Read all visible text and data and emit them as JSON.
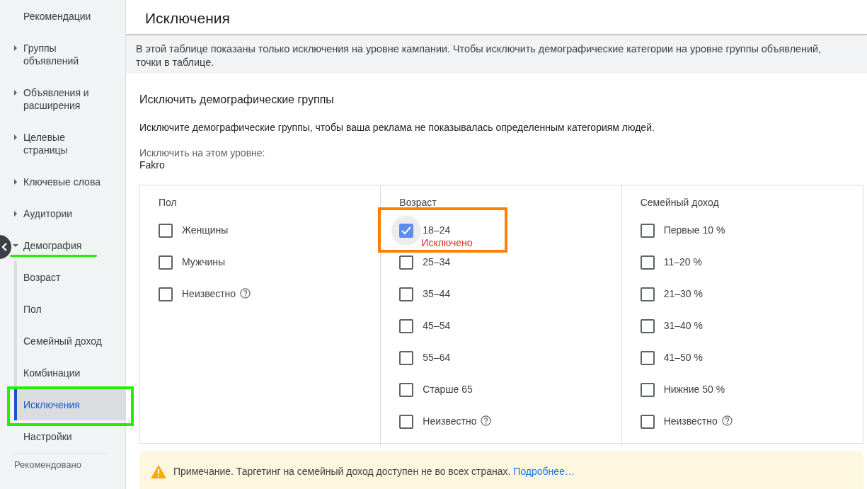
{
  "sidebar": {
    "items": [
      {
        "label": "Рекомендации",
        "kind": "plain"
      },
      {
        "label": "Группы объявлений",
        "kind": "collapsible",
        "expanded": false
      },
      {
        "label": "Объявления и расширения",
        "kind": "collapsible",
        "expanded": false
      },
      {
        "label": "Целевые страницы",
        "kind": "collapsible",
        "expanded": false
      },
      {
        "label": "Ключевые слова",
        "kind": "collapsible",
        "expanded": false
      },
      {
        "label": "Аудитории",
        "kind": "collapsible",
        "expanded": false
      },
      {
        "label": "Демография",
        "kind": "collapsible",
        "expanded": true,
        "annotation": {
          "kind": "underline",
          "color": "#22ee00"
        },
        "children": [
          {
            "label": "Возраст",
            "selected": false
          },
          {
            "label": "Пол",
            "selected": false
          },
          {
            "label": "Семейный доход",
            "selected": false
          },
          {
            "label": "Комбинации",
            "selected": false
          },
          {
            "label": "Исключения",
            "selected": true,
            "annotation": {
              "kind": "box",
              "color": "#22ee00"
            }
          }
        ]
      },
      {
        "label": "Настройки",
        "kind": "plain"
      }
    ],
    "footer": "Рекомендовано"
  },
  "page_title": "Исключения",
  "info_banner": {
    "lines": [
      "В этой таблице показаны только исключения на уровне кампании. Чтобы исключить демографические категории на уровне группы объявлений,",
      "точки в таблице."
    ]
  },
  "section": {
    "title": "Исключить демографические группы",
    "description": "Исключите демографические группы, чтобы ваша реклама не показывалась определенным категориям людей.",
    "level_label": "Исключить на этом уровне:",
    "level_value": "Fakro",
    "columns": [
      {
        "heading": "Пол",
        "options": [
          {
            "label": "Женщины",
            "checked": false
          },
          {
            "label": "Мужчины",
            "checked": false
          },
          {
            "label": "Неизвестно",
            "checked": false,
            "help": true
          }
        ]
      },
      {
        "heading": "Возраст",
        "options": [
          {
            "label": "18–24",
            "checked": true,
            "status": "Исключено",
            "annotation": {
              "kind": "box",
              "color": "#ff8000"
            }
          },
          {
            "label": "25–34",
            "checked": false
          },
          {
            "label": "35–44",
            "checked": false
          },
          {
            "label": "45–54",
            "checked": false
          },
          {
            "label": "55–64",
            "checked": false
          },
          {
            "label": "Старше 65",
            "checked": false
          },
          {
            "label": "Неизвестно",
            "checked": false,
            "help": true
          }
        ]
      },
      {
        "heading": "Семейный доход",
        "options": [
          {
            "label": "Первые 10 %",
            "checked": false
          },
          {
            "label": "11–20 %",
            "checked": false
          },
          {
            "label": "21–30 %",
            "checked": false
          },
          {
            "label": "31–40 %",
            "checked": false
          },
          {
            "label": "41–50 %",
            "checked": false
          },
          {
            "label": "Нижние 50 %",
            "checked": false
          },
          {
            "label": "Неизвестно",
            "checked": false,
            "help": true
          }
        ]
      }
    ]
  },
  "note": {
    "text": "Примечание. Таргетинг на семейный доход доступен не во всех странах.",
    "link": "Подробнее…"
  }
}
